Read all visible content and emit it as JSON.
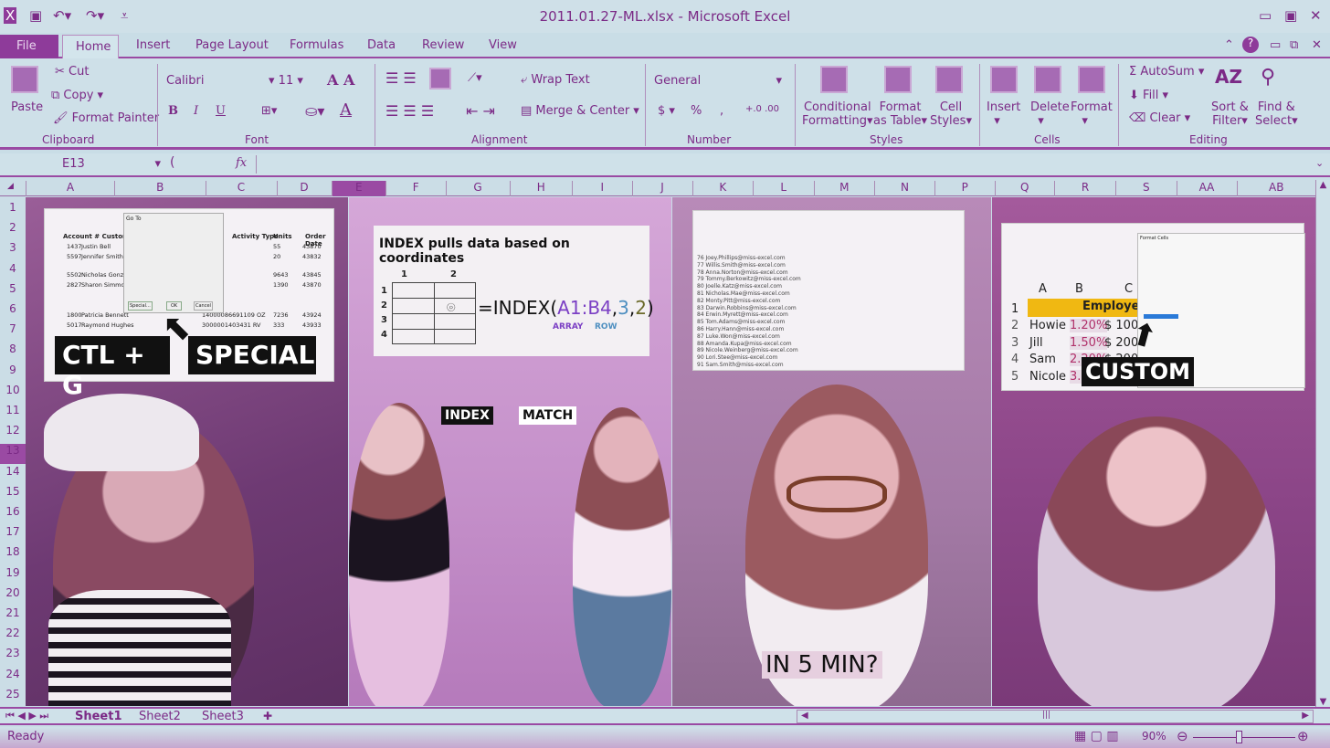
{
  "window": {
    "title": "2011.01.27-ML.xlsx - Microsoft Excel",
    "controls": [
      "minimize",
      "maximize",
      "close"
    ]
  },
  "quick_access": [
    "excel-logo",
    "save",
    "undo",
    "redo",
    "customize"
  ],
  "tabs": [
    "File",
    "Home",
    "Insert",
    "Page Layout",
    "Formulas",
    "Data",
    "Review",
    "View"
  ],
  "ribbon": {
    "clipboard": {
      "paste": "Paste",
      "cut": "Cut",
      "copy": "Copy",
      "format_painter": "Format Painter",
      "label": "Clipboard"
    },
    "font": {
      "name": "Calibri",
      "size": "11",
      "bold": "B",
      "italic": "I",
      "underline": "U",
      "label": "Font"
    },
    "alignment": {
      "wrap": "Wrap Text",
      "merge": "Merge & Center",
      "label": "Alignment"
    },
    "number": {
      "format": "General",
      "currency": "$",
      "percent": "%",
      "comma": ",",
      "label": "Number"
    },
    "styles": {
      "conditional": "Conditional",
      "conditional2": "Formatting",
      "table": "Format",
      "table2": "as Table",
      "cell": "Cell",
      "cell2": "Styles",
      "label": "Styles"
    },
    "cells": {
      "insert": "Insert",
      "delete": "Delete",
      "format": "Format",
      "label": "Cells"
    },
    "editing": {
      "autosum": "AutoSum",
      "fill": "Fill",
      "clear": "Clear",
      "sort": "Sort &",
      "sort2": "Filter",
      "find": "Find &",
      "find2": "Select",
      "label": "Editing"
    }
  },
  "formula_bar": {
    "name_box": "E13",
    "fx": "fx",
    "value": ""
  },
  "columns": [
    "A",
    "B",
    "C",
    "D",
    "E",
    "F",
    "G",
    "H",
    "I",
    "J",
    "K",
    "L",
    "M",
    "N",
    "P",
    "Q",
    "R",
    "S",
    "AA",
    "AB"
  ],
  "rows": [
    "1",
    "2",
    "3",
    "4",
    "5",
    "6",
    "7",
    "8",
    "9",
    "10",
    "11",
    "12",
    "13",
    "14",
    "15",
    "16",
    "17",
    "18",
    "19",
    "20",
    "21",
    "22",
    "23",
    "24",
    "25"
  ],
  "panel1": {
    "caption1": "CTL + G",
    "caption2": "SPECIAL",
    "headers": [
      "Account #",
      "Customer Name",
      "Activity Type",
      "Units",
      "Order Date"
    ],
    "rows": [
      [
        "1437",
        "Justin Bell",
        "722 OZ",
        "55",
        "43870"
      ],
      [
        "5597",
        "Jennifer Smith",
        "685 DA",
        "20",
        "43832"
      ],
      [
        "5502",
        "Nicholas Gonz",
        "075 KG",
        "9643",
        "43845"
      ],
      [
        "2827",
        "Sharon Simmo",
        "346 OZ",
        "1390",
        "43870"
      ],
      [
        "1800",
        "Patricia Bennett",
        "14000086691109 OZ",
        "7236",
        "43924"
      ],
      [
        "5017",
        "Raymond Hughes",
        "3000001403431 RV",
        "333",
        "43933"
      ]
    ],
    "dialog": {
      "title": "Go To",
      "special": "Special...",
      "ok": "OK",
      "cancel": "Cancel"
    }
  },
  "panel2": {
    "heading": "INDEX pulls data based on coordinates",
    "grid_cols": [
      "1",
      "2"
    ],
    "grid_rows": [
      "1",
      "2",
      "3",
      "4"
    ],
    "formula_prefix": "=INDEX(",
    "formula_array": "A1:B4",
    "formula_comma1": ",",
    "formula_row": "3",
    "formula_comma2": ",",
    "formula_col": "2",
    "formula_suffix": ")",
    "label_array": "ARRAY",
    "label_row": "ROW",
    "tag1": "INDEX",
    "tag2": "MATCH",
    "colors": {
      "array": "#7b3fc4",
      "row": "#4e8fc0",
      "col": "#6b6a2a"
    }
  },
  "panel3": {
    "emails": [
      "76 Joey.Phillips@miss-excel.com",
      "77 Willis.Smith@miss-excel.com",
      "78 Anna.Norton@miss-excel.com",
      "79 Tommy.Berkowitz@miss-excel.com",
      "80 Joelle.Katz@miss-excel.com",
      "81 Nicholas.Mae@miss-excel.com",
      "82 Monty.Pitt@miss-excel.com",
      "83 Darwin.Robbins@miss-excel.com",
      "84 Erwin.Myrett@miss-excel.com",
      "85 Tom.Adams@miss-excel.com",
      "86 Harry.Hann@miss-excel.com",
      "87 Luke.Won@miss-excel.com",
      "88 Amanda.Kupa@miss-excel.com",
      "89 Nicole.Weinberg@miss-excel.com",
      "90 Lori.Stee@miss-excel.com",
      "91 Sam.Smith@miss-excel.com"
    ],
    "caption": "IN 5 MIN?"
  },
  "panel4": {
    "cols": [
      "A",
      "B",
      "C"
    ],
    "header": "Employee",
    "rows": [
      [
        "2",
        "Howie",
        "1.20%",
        "$ 100"
      ],
      [
        "3",
        "Jill",
        "1.50%",
        "$ 200"
      ],
      [
        "4",
        "Sam",
        "2.20%",
        "$ 200"
      ],
      [
        "5",
        "Nicole",
        "3.20%",
        ""
      ]
    ],
    "caption": "CUSTOM",
    "dialog_title": "Format Cells"
  },
  "sheets": {
    "tabs": [
      "Sheet1",
      "Sheet2",
      "Sheet3"
    ],
    "active": "Sheet1"
  },
  "status": {
    "text": "Ready",
    "zoom": "90%",
    "zoom_level": 0.45
  }
}
